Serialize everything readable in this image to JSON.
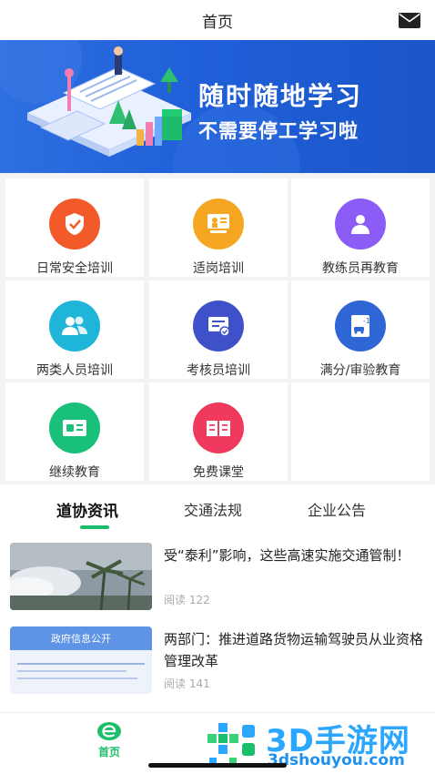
{
  "header": {
    "title": "首页",
    "mail_icon": "mail-icon"
  },
  "banner": {
    "line1": "随时随地学习",
    "line2": "不需要停工学习啦"
  },
  "menu": [
    {
      "label": "日常安全培训",
      "icon": "shield-icon",
      "color": "#f25a2a"
    },
    {
      "label": "适岗培训",
      "icon": "presentation-board-icon",
      "color": "#f5a623"
    },
    {
      "label": "教练员再教育",
      "icon": "instructor-icon",
      "color": "#8b5cf6"
    },
    {
      "label": "两类人员培训",
      "icon": "two-people-icon",
      "color": "#1eb5d8"
    },
    {
      "label": "考核员培训",
      "icon": "certificate-icon",
      "color": "#3f51c9"
    },
    {
      "label": "满分/审验教育",
      "icon": "car-score-icon",
      "color": "#2f66d6"
    },
    {
      "label": "继续教育",
      "icon": "id-card-icon",
      "color": "#19c07a"
    },
    {
      "label": "免费课堂",
      "icon": "open-book-icon",
      "color": "#ef3a5d"
    }
  ],
  "tabs": [
    {
      "label": "道协资讯",
      "active": true
    },
    {
      "label": "交通法规",
      "active": false
    },
    {
      "label": "企业公告",
      "active": false
    }
  ],
  "news": [
    {
      "headline": "受“泰利”影响，这些高速实施交通管制！",
      "reads": "阅读 122",
      "thumb": "typhoon-photo"
    },
    {
      "headline": "两部门：推进道路货物运输驾驶员从业资格管理改革",
      "reads": "阅读 141",
      "thumb": "gov-notice-screenshot",
      "thumb_text": "政府信息公开"
    }
  ],
  "bottom_nav": {
    "home_label": "首页",
    "home_icon": "e-logo-icon"
  },
  "watermark": {
    "big": "3D手游网",
    "small": "3dshouyou.com"
  }
}
